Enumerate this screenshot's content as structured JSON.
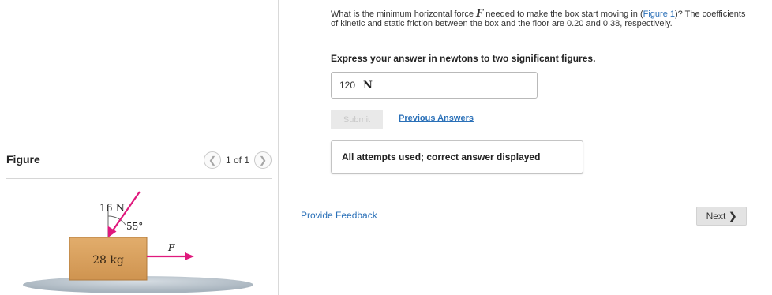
{
  "figure": {
    "title": "Figure",
    "pager": {
      "text": "1 of 1",
      "prev_icon": "chevron-left-icon",
      "next_icon": "chevron-right-icon"
    },
    "diagram": {
      "force_label": "16 N",
      "angle_label": "55°",
      "mass_label": "28 kg",
      "horizontal_force_label": "F",
      "colors": {
        "box": "#d9a15e",
        "box_edge": "#b17a3b",
        "arrow": "#e0197d",
        "floor": "#b8c3cc"
      }
    }
  },
  "question": {
    "text_part1": "What is the minimum horizontal force ",
    "variable": "F",
    "text_part2": " needed to make the box start moving in (",
    "figure_link": "Figure 1",
    "text_part3": ")? The coefficients of kinetic and static friction between the box and the floor are 0.20 and 0.38, respectively.",
    "instruction": "Express your answer in newtons to two significant figures.",
    "answer": {
      "value": "120",
      "unit": "N"
    },
    "submit_label": "Submit",
    "previous_answers_label": "Previous Answers",
    "status": "All attempts used; correct answer displayed"
  },
  "footer": {
    "feedback_label": "Provide Feedback",
    "next_label": "Next",
    "next_icon": "chevron-right-icon"
  }
}
